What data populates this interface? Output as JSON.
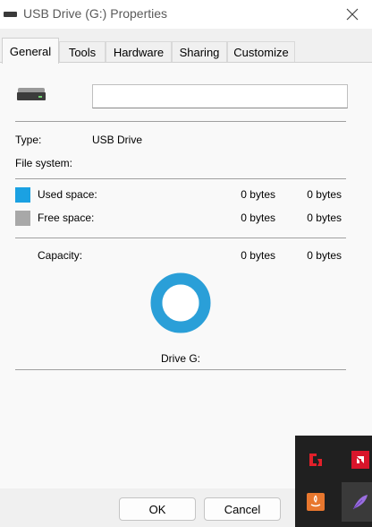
{
  "window": {
    "title": "USB Drive (G:) Properties",
    "close_glyph": "✕"
  },
  "tabs": [
    {
      "label": "General",
      "active": true
    },
    {
      "label": "Tools"
    },
    {
      "label": "Hardware"
    },
    {
      "label": "Sharing"
    },
    {
      "label": "Customize"
    }
  ],
  "general": {
    "name_value": "",
    "type_label": "Type:",
    "type_value": "USB Drive",
    "filesystem_label": "File system:",
    "used": {
      "label": "Used space:",
      "bytes": "0 bytes",
      "size": "0 bytes",
      "color": "#1ba1e2"
    },
    "free": {
      "label": "Free space:",
      "bytes": "0 bytes",
      "size": "0 bytes",
      "color": "#a8a8a8"
    },
    "capacity": {
      "label": "Capacity:",
      "bytes": "0 bytes",
      "size": "0 bytes"
    },
    "drive_label": "Drive G:",
    "ring_color": "#2a9fd8"
  },
  "buttons": {
    "ok": "OK",
    "cancel": "Cancel"
  },
  "tray": {
    "icons": [
      "amd-radeon-icon",
      "amd-logo-icon",
      "java-icon",
      "feather-pen-icon"
    ]
  }
}
